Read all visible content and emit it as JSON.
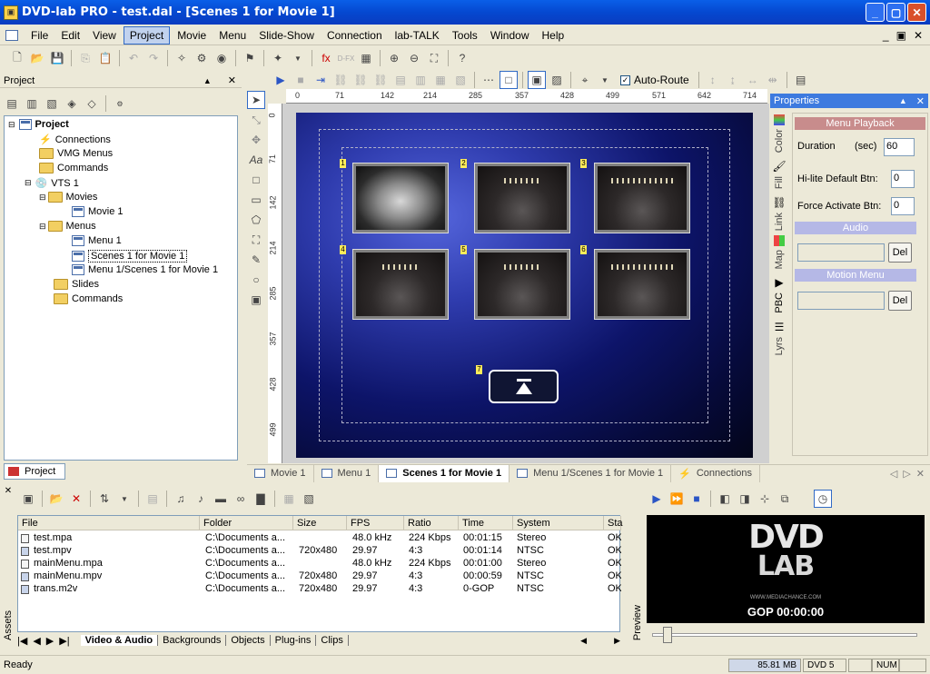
{
  "window": {
    "title": "DVD-lab PRO - test.dal - [Scenes 1 for Movie 1]",
    "min": "_",
    "max": "▢",
    "close": "✕"
  },
  "menu": [
    "File",
    "Edit",
    "View",
    "Project",
    "Movie",
    "Menu",
    "Slide-Show",
    "Connection",
    "lab-TALK",
    "Tools",
    "Window",
    "Help"
  ],
  "toolbar2": {
    "auto_route": "Auto-Route"
  },
  "project_panel": {
    "title": "Project",
    "tab": "Project",
    "tree": {
      "root": "Project",
      "connections": "Connections",
      "vmg_menus": "VMG Menus",
      "commands": "Commands",
      "vts": "VTS 1",
      "movies": "Movies",
      "movie1": "Movie 1",
      "menus": "Menus",
      "menu1": "Menu 1",
      "scenes": "Scenes 1 for Movie 1",
      "menu1_scenes": "Menu 1/Scenes 1 for Movie 1",
      "slides": "Slides",
      "commands2": "Commands"
    }
  },
  "ruler": {
    "h": [
      "0",
      "71",
      "142",
      "214",
      "285",
      "357",
      "428",
      "499",
      "571",
      "642",
      "714"
    ],
    "v": [
      "0",
      "71",
      "142",
      "214",
      "285",
      "357",
      "428",
      "499"
    ]
  },
  "canvas": {
    "button_numbers": [
      "1",
      "2",
      "3",
      "4",
      "5",
      "6",
      "7"
    ]
  },
  "properties": {
    "title": "Properties",
    "section_menu_playback": "Menu Playback",
    "duration_label": "Duration",
    "duration_unit": "(sec)",
    "duration_value": "60",
    "hilite_label": "Hi-lite Default Btn:",
    "hilite_value": "0",
    "force_label": "Force Activate Btn:",
    "force_value": "0",
    "audio_label": "Audio",
    "del1": "Del",
    "motion_label": "Motion Menu",
    "del2": "Del",
    "side_tabs": [
      "Color",
      "Fill",
      "Link",
      "Map",
      "PBC",
      "Lyrs"
    ]
  },
  "doc_tabs": [
    "Movie 1",
    "Menu 1",
    "Scenes 1 for Movie 1",
    "Menu 1/Scenes 1 for Movie 1",
    "Connections"
  ],
  "assets": {
    "label": "Assets",
    "columns": [
      "File",
      "Folder",
      "Size",
      "FPS",
      "Ratio",
      "Time",
      "System",
      "Sta"
    ],
    "rows": [
      [
        "test.mpa",
        "C:\\Documents a...",
        "",
        "48.0 kHz",
        "224 Kbps",
        "00:01:15",
        "Stereo",
        "OK"
      ],
      [
        "test.mpv",
        "C:\\Documents a...",
        "720x480",
        "29.97",
        "4:3",
        "00:01:14",
        "NTSC",
        "OK"
      ],
      [
        "mainMenu.mpa",
        "C:\\Documents a...",
        "",
        "48.0 kHz",
        "224 Kbps",
        "00:01:00",
        "Stereo",
        "OK"
      ],
      [
        "mainMenu.mpv",
        "C:\\Documents a...",
        "720x480",
        "29.97",
        "4:3",
        "00:00:59",
        "NTSC",
        "OK"
      ],
      [
        "trans.m2v",
        "C:\\Documents a...",
        "720x480",
        "29.97",
        "4:3",
        "0-GOP",
        "NTSC",
        "OK"
      ]
    ],
    "tabs": [
      "Video & Audio",
      "Backgrounds",
      "Objects",
      "Plug-ins",
      "Clips"
    ]
  },
  "preview": {
    "label": "Preview",
    "logo_line1": "DVD",
    "logo_line2": "LAB",
    "logo_url": "WWW.MEDIACHANCE.COM",
    "gop": "GOP 00:00:00"
  },
  "status": {
    "text": "Ready",
    "memory": "85.81 MB",
    "dvd": "DVD 5",
    "num": "NUM"
  }
}
